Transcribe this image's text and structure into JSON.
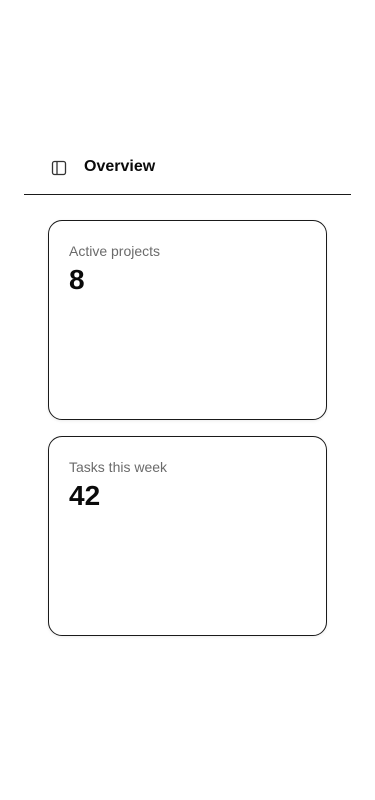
{
  "header": {
    "title": "Overview",
    "toggle_icon": "sidebar-panel-icon"
  },
  "stats": [
    {
      "label": "Active projects",
      "value": "8"
    },
    {
      "label": "Tasks this week",
      "value": "42"
    }
  ]
}
